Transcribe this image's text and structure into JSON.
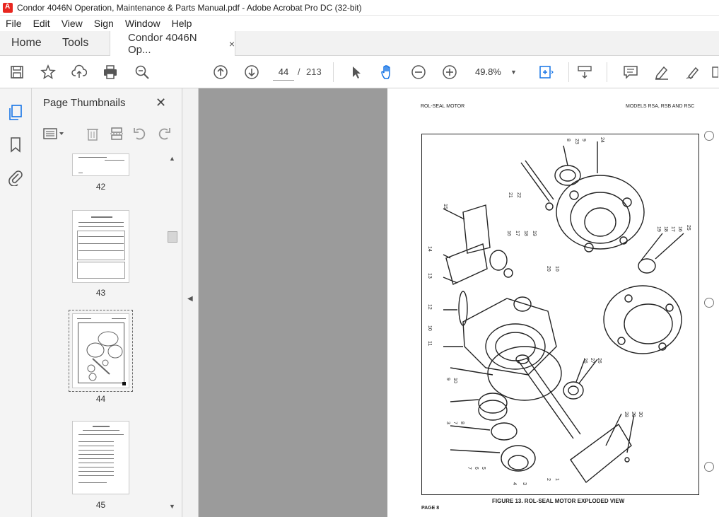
{
  "window": {
    "title": "Condor 4046N Operation, Maintenance & Parts Manual.pdf - Adobe Acrobat Pro DC (32-bit)"
  },
  "menu": [
    "File",
    "Edit",
    "View",
    "Sign",
    "Window",
    "Help"
  ],
  "tabs": {
    "home": "Home",
    "tools": "Tools",
    "document": "Condor 4046N Op...",
    "close": "×"
  },
  "toolbar": {
    "current_page": "44",
    "page_separator": "/",
    "total_pages": "213",
    "zoom": "49.8%"
  },
  "thumbnails_panel": {
    "title": "Page Thumbnails",
    "close": "✕",
    "pages": [
      {
        "label": "42"
      },
      {
        "label": "43"
      },
      {
        "label": "44",
        "selected": true
      },
      {
        "label": "45"
      }
    ]
  },
  "document_page": {
    "header_left": "ROL-SEAL MOTOR",
    "header_right": "MODELS RSA, RSB AND RSC",
    "caption": "FIGURE 13.  ROL-SEAL MOTOR EXPLODED VIEW",
    "page_label": "PAGE 8",
    "callouts": [
      "24",
      "23",
      "9",
      "8",
      "21",
      "22",
      "15",
      "16",
      "17",
      "18",
      "19",
      "14",
      "20",
      "10",
      "13",
      "12",
      "10",
      "11",
      "19",
      "18",
      "17",
      "16",
      "25",
      "9",
      "10",
      "26",
      "27",
      "26",
      "3",
      "7",
      "8",
      "28",
      "29",
      "30",
      "7",
      "6",
      "5",
      "4",
      "3",
      "2",
      "1"
    ]
  },
  "icons": {
    "save": "save-icon",
    "bookmark": "star-icon",
    "upload": "cloud-upload-icon",
    "print": "printer-icon",
    "search": "zoom-search-icon",
    "prev_page": "arrow-up-circle-icon",
    "next_page": "arrow-down-circle-icon",
    "select": "cursor-arrow-icon",
    "hand": "hand-icon",
    "zoom_out": "minus-circle-icon",
    "zoom_in": "plus-circle-icon"
  }
}
